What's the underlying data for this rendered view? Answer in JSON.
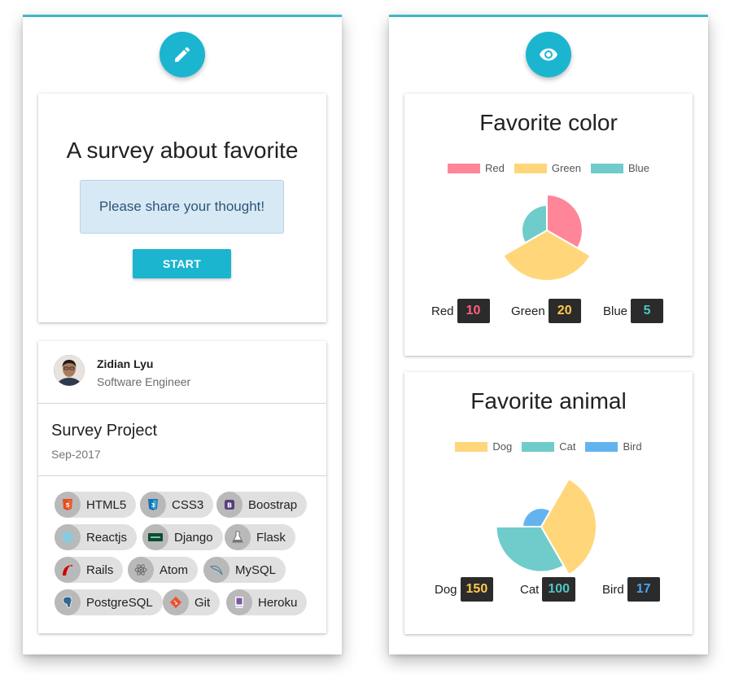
{
  "survey": {
    "title": "A survey about favorite",
    "alert": "Please share your thought!",
    "start_label": "START"
  },
  "profile": {
    "name": "Zidian Lyu",
    "role": "Software Engineer",
    "project_title": "Survey Project",
    "project_date": "Sep-2017",
    "skills": [
      {
        "label": "HTML5",
        "icon": "html5-icon"
      },
      {
        "label": "CSS3",
        "icon": "css3-icon"
      },
      {
        "label": "Boostrap",
        "icon": "bootstrap-icon"
      },
      {
        "label": "Reactjs",
        "icon": "react-icon"
      },
      {
        "label": "Django",
        "icon": "django-icon"
      },
      {
        "label": "Flask",
        "icon": "flask-icon"
      },
      {
        "label": "Rails",
        "icon": "rails-icon"
      },
      {
        "label": "Atom",
        "icon": "atom-icon"
      },
      {
        "label": "MySQL",
        "icon": "mysql-icon"
      },
      {
        "label": "PostgreSQL",
        "icon": "postgresql-icon"
      },
      {
        "label": "Git",
        "icon": "git-icon"
      },
      {
        "label": "Heroku",
        "icon": "heroku-icon"
      }
    ]
  },
  "icons": {
    "editor_fab": "pencil-icon",
    "preview_fab": "eye-icon"
  },
  "colors": {
    "accent": "#1cb5cf",
    "panel_border": "#3fb8c4",
    "value_box": "#2b2b2b"
  },
  "chart_data": [
    {
      "type": "pie",
      "title": "Favorite color",
      "categories": [
        "Red",
        "Green",
        "Blue"
      ],
      "values": [
        10,
        20,
        5
      ],
      "colors": [
        "#ff8599",
        "#ffd67a",
        "#6fcccb"
      ],
      "legend": "top",
      "stats": [
        {
          "label": "Red",
          "value": "10",
          "color": "#ff5f7e"
        },
        {
          "label": "Green",
          "value": "20",
          "color": "#ffc94a"
        },
        {
          "label": "Blue",
          "value": "5",
          "color": "#4fc6c4"
        }
      ]
    },
    {
      "type": "pie",
      "title": "Favorite animal",
      "categories": [
        "Dog",
        "Cat",
        "Bird"
      ],
      "values": [
        150,
        100,
        17
      ],
      "colors": [
        "#ffd67a",
        "#6fcccb",
        "#63b3ef"
      ],
      "legend": "top",
      "stats": [
        {
          "label": "Dog",
          "value": "150",
          "color": "#ffc94a"
        },
        {
          "label": "Cat",
          "value": "100",
          "color": "#4fc6c4"
        },
        {
          "label": "Bird",
          "value": "17",
          "color": "#4aa5ee"
        }
      ]
    }
  ]
}
